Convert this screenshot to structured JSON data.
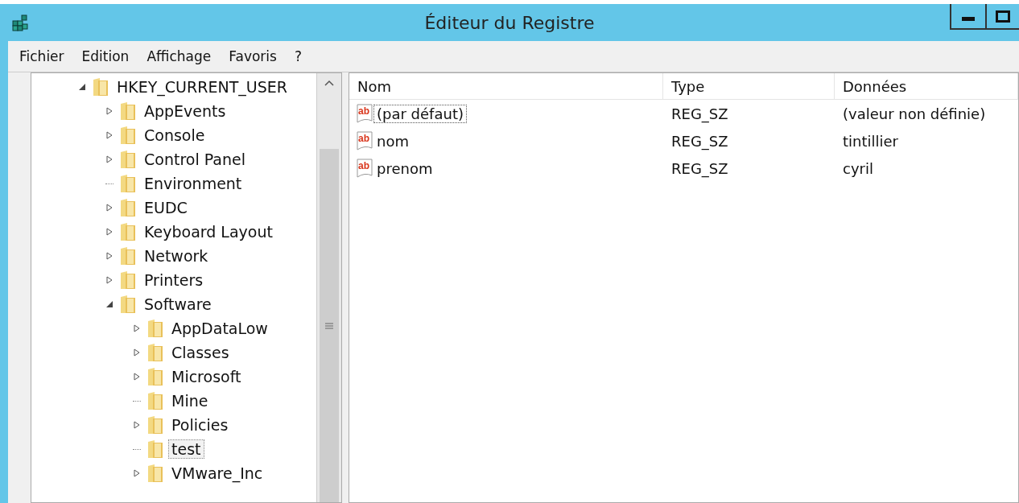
{
  "window": {
    "title": "Éditeur du Registre"
  },
  "menu": [
    "Fichier",
    "Edition",
    "Affichage",
    "Favoris",
    "?"
  ],
  "tree": [
    {
      "label": "HKEY_CURRENT_USER",
      "kind": "expanded",
      "selected": false,
      "children": [
        {
          "label": "AppEvents",
          "kind": "collapsed",
          "selected": false
        },
        {
          "label": "Console",
          "kind": "collapsed",
          "selected": false
        },
        {
          "label": "Control Panel",
          "kind": "collapsed",
          "selected": false
        },
        {
          "label": "Environment",
          "kind": "leaf",
          "selected": false
        },
        {
          "label": "EUDC",
          "kind": "collapsed",
          "selected": false
        },
        {
          "label": "Keyboard Layout",
          "kind": "collapsed",
          "selected": false
        },
        {
          "label": "Network",
          "kind": "collapsed",
          "selected": false
        },
        {
          "label": "Printers",
          "kind": "collapsed",
          "selected": false
        },
        {
          "label": "Software",
          "kind": "expanded",
          "selected": false,
          "children": [
            {
              "label": "AppDataLow",
              "kind": "collapsed",
              "selected": false
            },
            {
              "label": "Classes",
              "kind": "collapsed",
              "selected": false
            },
            {
              "label": "Microsoft",
              "kind": "collapsed",
              "selected": false
            },
            {
              "label": "Mine",
              "kind": "leaf",
              "selected": false
            },
            {
              "label": "Policies",
              "kind": "collapsed",
              "selected": false
            },
            {
              "label": "test",
              "kind": "leaf",
              "selected": true
            },
            {
              "label": "VMware_Inc",
              "kind": "collapsed",
              "selected": false
            }
          ]
        }
      ]
    }
  ],
  "columns": [
    "Nom",
    "Type",
    "Données"
  ],
  "values": [
    {
      "icon_text": "ab",
      "name": "(par défaut)",
      "type": "REG_SZ",
      "data": "(valeur non définie)",
      "selected": true
    },
    {
      "icon_text": "ab",
      "name": "nom",
      "type": "REG_SZ",
      "data": "tintillier",
      "selected": false
    },
    {
      "icon_text": "ab",
      "name": "prenom",
      "type": "REG_SZ",
      "data": "cyril",
      "selected": false
    }
  ]
}
